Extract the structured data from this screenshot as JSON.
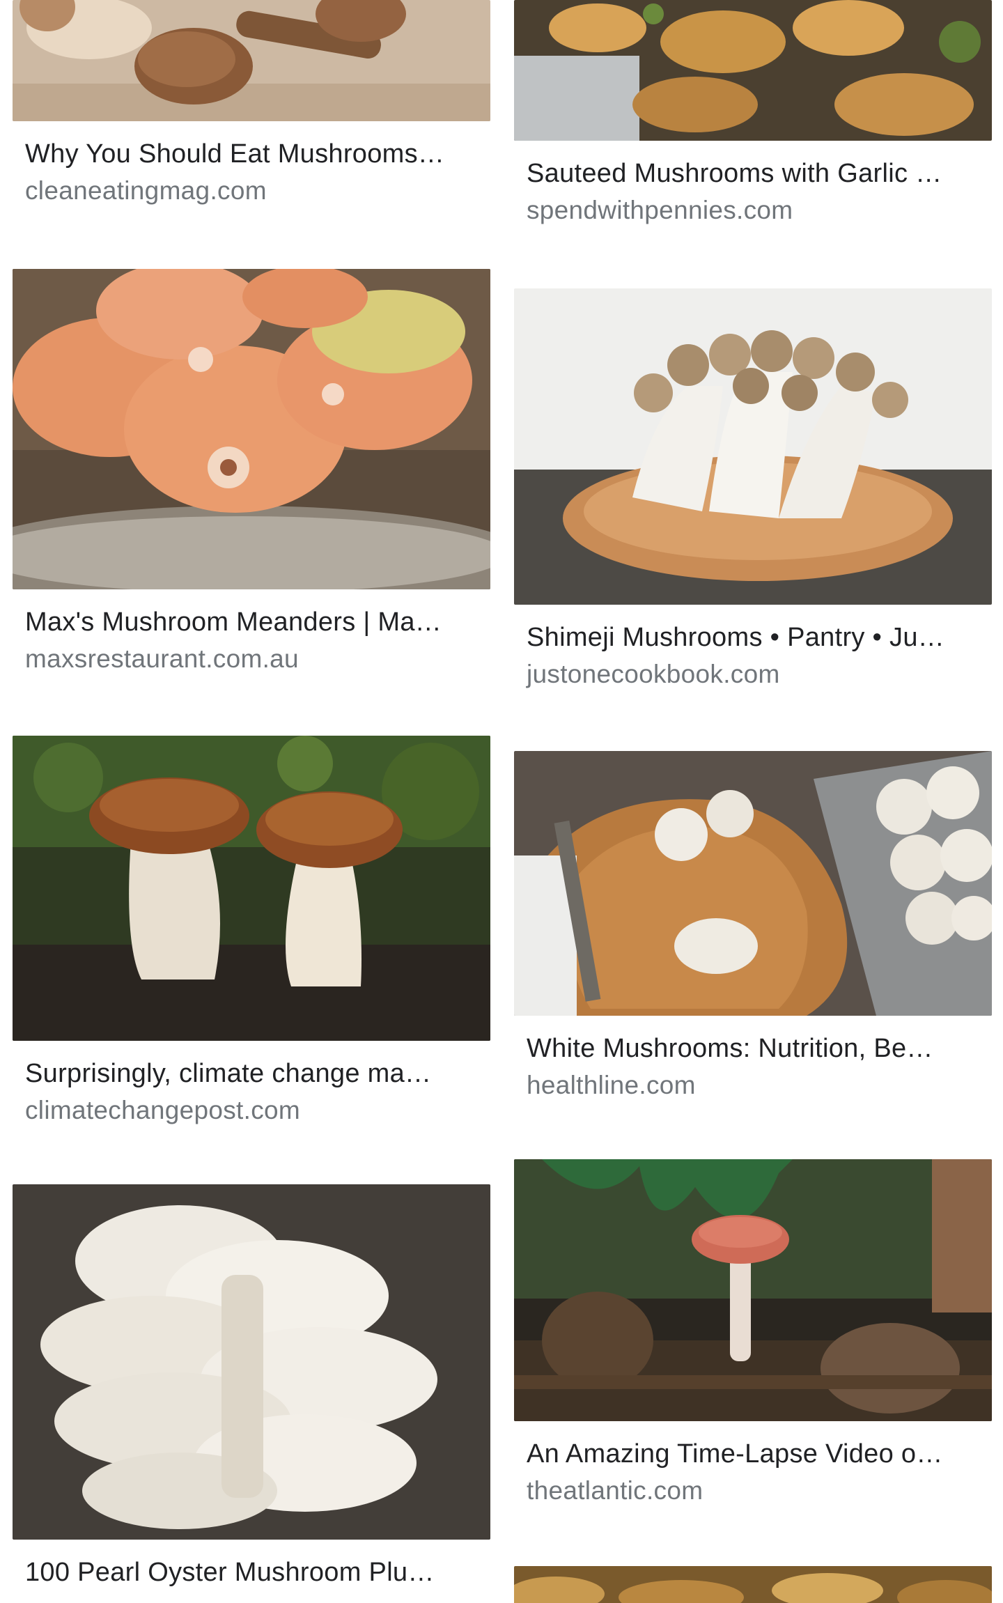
{
  "results": {
    "left": [
      {
        "title": "Why You Should Eat Mushrooms…",
        "source": "cleaneatingmag.com",
        "image": "shiitake-mushrooms-image"
      },
      {
        "title": "Max's Mushroom Meanders | Ma…",
        "source": "maxsrestaurant.com.au",
        "image": "orange-mushrooms-basket-image"
      },
      {
        "title": "Surprisingly, climate change ma…",
        "source": "climatechangepost.com",
        "image": "porcini-mushrooms-forest-image"
      },
      {
        "title": "100 Pearl Oyster Mushroom Plu…",
        "source": "",
        "image": "oyster-mushrooms-image"
      }
    ],
    "right": [
      {
        "title": "Sauteed Mushrooms with Garlic …",
        "source": "spendwithpennies.com",
        "image": "sauteed-mushrooms-image"
      },
      {
        "title": "Shimeji Mushrooms • Pantry • Ju…",
        "source": "justonecookbook.com",
        "image": "shimeji-mushrooms-image"
      },
      {
        "title": "White Mushrooms: Nutrition, Be…",
        "source": "healthline.com",
        "image": "white-mushrooms-board-image"
      },
      {
        "title": "An Amazing Time-Lapse Video o…",
        "source": "theatlantic.com",
        "image": "timelapse-mushroom-image"
      },
      {
        "title": "",
        "source": "",
        "image": "partial-mushroom-image"
      }
    ]
  },
  "colors": {
    "title": "#202124",
    "source": "#70757a",
    "background": "#ffffff"
  }
}
